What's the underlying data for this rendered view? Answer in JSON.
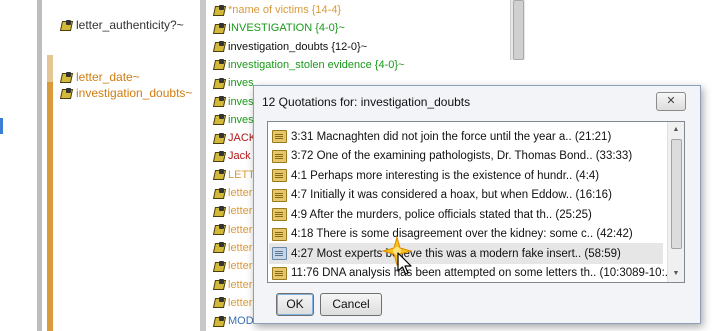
{
  "left_panel": {
    "labels": [
      "letter_authenticity?~",
      "letter_date~",
      "investigation_doubts~"
    ]
  },
  "code_list": {
    "items": [
      {
        "text": "*name of victims {14-4}",
        "color": "#d99a3c"
      },
      {
        "text": "INVESTIGATION {4-0}~",
        "color": "#1a9a1a"
      },
      {
        "text": "investigation_doubts {12-0}~",
        "color": "#111111",
        "selected": true
      },
      {
        "text": "investigation_stolen evidence {4-0}~",
        "color": "#1a9a1a"
      },
      {
        "text": "inves",
        "color": "#1a9a1a"
      },
      {
        "text": "inves",
        "color": "#1a9a1a"
      },
      {
        "text": "inves",
        "color": "#1a9a1a"
      },
      {
        "text": "JACK",
        "color": "#b01818"
      },
      {
        "text": "Jack",
        "color": "#b01818"
      },
      {
        "text": "LETT",
        "color": "#d99a3c"
      },
      {
        "text": "letter",
        "color": "#d99a3c"
      },
      {
        "text": "letter",
        "color": "#d99a3c"
      },
      {
        "text": "letter",
        "color": "#d99a3c"
      },
      {
        "text": "letter",
        "color": "#d99a3c"
      },
      {
        "text": "letter",
        "color": "#d99a3c"
      },
      {
        "text": "letter",
        "color": "#d99a3c"
      },
      {
        "text": "letter",
        "color": "#d99a3c"
      },
      {
        "text": "MOD",
        "color": "#3a6fb0"
      }
    ]
  },
  "dialog": {
    "title": "12 Quotations for: investigation_doubts",
    "close_label": "✕",
    "quotations": [
      "3:31 Macnaghten did not join the force until the year a.. (21:21)",
      "3:72 One of the examining pathologists, Dr. Thomas Bond.. (33:33)",
      "4:1 Perhaps more interesting is the existence of hundr.. (4:4)",
      "4:7 Initially it was considered a hoax, but when Eddow.. (16:16)",
      "4:9 After the murders, police officials stated that th.. (25:25)",
      "4:18 There is some disagreement over the kidney: some c.. (42:42)",
      "4:27 Most experts believe this was a modern fake insert.. (58:59)",
      "11:76 DNA analysis has been attempted on some letters th.. (10:3089-10:..."
    ],
    "selected_index": 6,
    "ok_label": "OK",
    "cancel_label": "Cancel"
  },
  "colors": {
    "accent_blue": "#3a7fd5",
    "code_icon": "#d2b93a",
    "dialog_border": "#8da0ba",
    "selected_row": "#e6e6e6"
  },
  "icons": {
    "code": "code-icon",
    "quotation": "document-icon",
    "close": "close-icon",
    "cursor": "pointer-cursor-icon"
  }
}
